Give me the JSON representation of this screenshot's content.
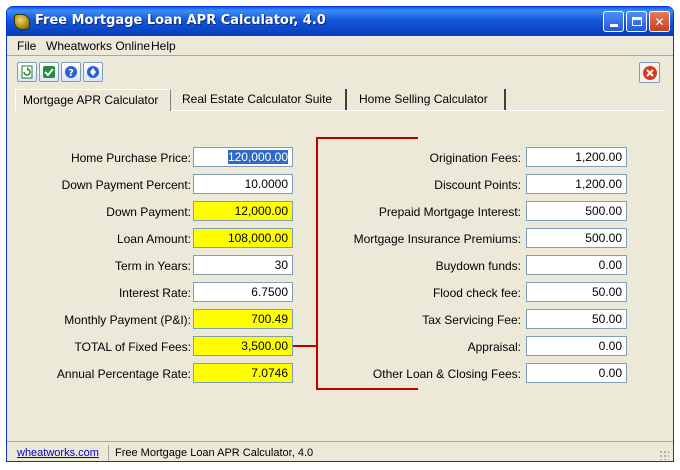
{
  "window": {
    "title": "Free Mortgage Loan APR Calculator, 4.0"
  },
  "menu": [
    "File",
    "Wheatworks Online",
    "Help"
  ],
  "toolbar": {
    "icons": [
      "refresh-icon",
      "check-icon",
      "help-icon",
      "info-icon"
    ],
    "stop_icon": "stop-icon"
  },
  "tabs": [
    {
      "label": "Mortgage APR Calculator",
      "active": true
    },
    {
      "label": "Real Estate Calculator Suite",
      "active": false
    },
    {
      "label": "Home Selling Calculator",
      "active": false
    }
  ],
  "left_fields": [
    {
      "label": "Home Purchase Price:",
      "value": "120,000.00",
      "style": "white",
      "selected": true
    },
    {
      "label": "Down Payment Percent:",
      "value": "10.0000",
      "style": "white"
    },
    {
      "label": "Down Payment:",
      "value": "12,000.00",
      "style": "yellow"
    },
    {
      "label": "Loan Amount:",
      "value": "108,000.00",
      "style": "yellow"
    },
    {
      "label": "Term in Years:",
      "value": "30",
      "style": "white"
    },
    {
      "label": "Interest Rate:",
      "value": "6.7500",
      "style": "white"
    },
    {
      "label": "Monthly Payment (P&I):",
      "value": "700.49",
      "style": "yellow"
    },
    {
      "label": "TOTAL of Fixed Fees:",
      "value": "3,500.00",
      "style": "yellow"
    },
    {
      "label": "Annual Percentage Rate:",
      "value": "7.0746",
      "style": "yellow"
    }
  ],
  "right_fields": [
    {
      "label": "Origination Fees:",
      "value": "1,200.00"
    },
    {
      "label": "Discount Points:",
      "value": "1,200.00"
    },
    {
      "label": "Prepaid Mortgage Interest:",
      "value": "500.00"
    },
    {
      "label": "Mortgage Insurance Premiums:",
      "value": "500.00"
    },
    {
      "label": "Buydown funds:",
      "value": "0.00"
    },
    {
      "label": "Flood check fee:",
      "value": "50.00"
    },
    {
      "label": "Tax Servicing Fee:",
      "value": "50.00"
    },
    {
      "label": "Appraisal:",
      "value": "0.00"
    },
    {
      "label": "Other Loan & Closing Fees:",
      "value": "0.00"
    }
  ],
  "colors": {
    "bracket": "#c00000",
    "highlight": "#ffff00",
    "titlebar": "#0b46c7"
  },
  "statusbar": {
    "link": "wheatworks.com",
    "text": "Free Mortgage Loan APR Calculator, 4.0"
  }
}
